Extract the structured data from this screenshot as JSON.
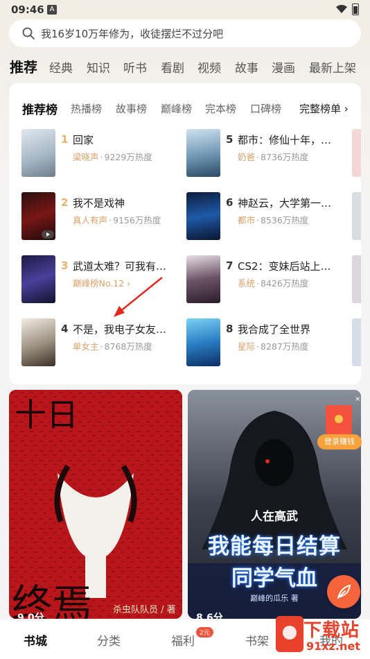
{
  "status_bar": {
    "time": "09:46"
  },
  "search": {
    "placeholder": "我16岁10万年修为，收徒摆烂不过分吧"
  },
  "category_tabs": [
    "推荐",
    "经典",
    "知识",
    "听书",
    "看剧",
    "视频",
    "故事",
    "漫画",
    "最新上架"
  ],
  "ranking": {
    "tabs": [
      "推荐榜",
      "热播榜",
      "故事榜",
      "巅峰榜",
      "完本榜",
      "口碑榜"
    ],
    "more": "完整榜单 ›",
    "items": [
      {
        "rank": "1",
        "title": "回家",
        "tag": "梁晓声",
        "dot": "·",
        "heat": "9229万热度",
        "rank_color": "#e8b26b"
      },
      {
        "rank": "2",
        "title": "我不是戏神",
        "tag": "真人有声",
        "dot": "·",
        "heat": "9156万热度",
        "rank_color": "#e8b26b"
      },
      {
        "rank": "3",
        "title": "武道太难？可我有…",
        "tag": "巅峰榜No.12 ›",
        "dot": "",
        "heat": "",
        "rank_color": "#e8b26b"
      },
      {
        "rank": "4",
        "title": "不是，我电子女友…",
        "tag": "单女主",
        "dot": "·",
        "heat": "8768万热度",
        "rank_color": "#333333"
      },
      {
        "rank": "5",
        "title": "都市：修仙十年，…",
        "tag": "奶爸",
        "dot": "·",
        "heat": "8736万热度",
        "rank_color": "#333333"
      },
      {
        "rank": "6",
        "title": "神赵云，大学第一…",
        "tag": "都市",
        "dot": "·",
        "heat": "8536万热度",
        "rank_color": "#333333"
      },
      {
        "rank": "7",
        "title": "CS2：变妹后站上…",
        "tag": "系统",
        "dot": "·",
        "heat": "8426万热度",
        "rank_color": "#333333"
      },
      {
        "rank": "8",
        "title": "我合成了全世界",
        "tag": "星际",
        "dot": "·",
        "heat": "8287万热度",
        "rank_color": "#333333"
      }
    ]
  },
  "feature_left": {
    "title_top": "十日",
    "title_bottom": "终焉",
    "author": "杀虫队队员 / 著",
    "score": "9.0分"
  },
  "feature_right": {
    "line1": "人在高武",
    "line2": "我能每日结算",
    "line3": "同学气血",
    "author": "巅峰的瓜乐 著",
    "score": "8.6分"
  },
  "promo": {
    "close": "×",
    "label": "登录赚钱"
  },
  "bottom_nav": {
    "items": [
      "书城",
      "分类",
      "福利",
      "书架",
      "我的"
    ],
    "badge": "2元"
  },
  "watermark": {
    "line1": "下载站",
    "line2": "91xz.net"
  },
  "colors": {
    "accent": "#f6643c",
    "tag": "#d9a06a",
    "top_rank": "#e8b26b"
  }
}
